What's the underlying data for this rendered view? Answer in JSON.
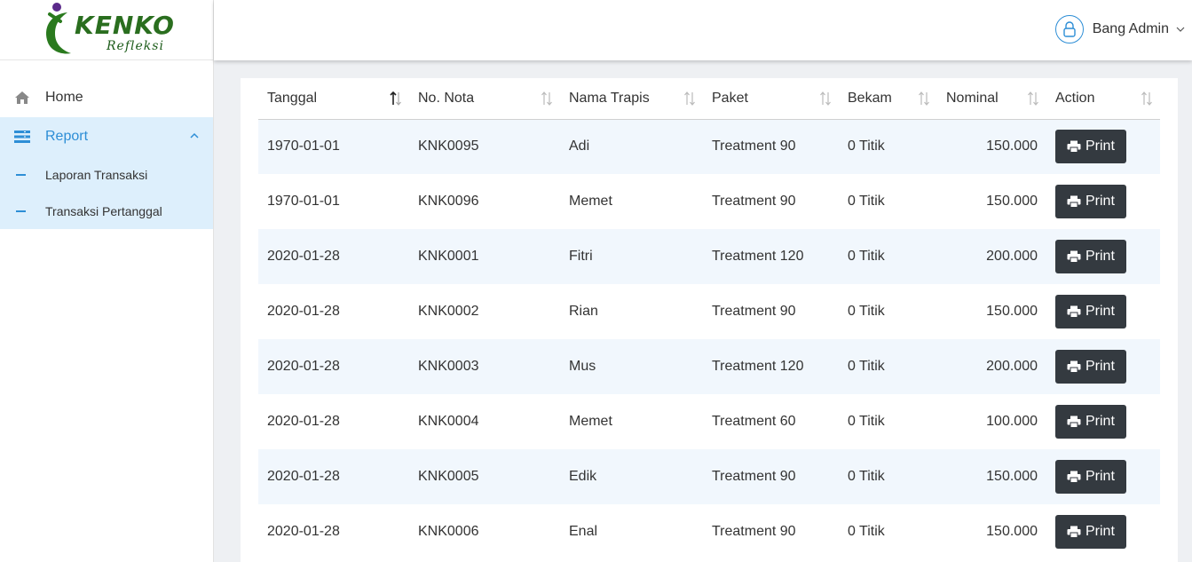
{
  "brand": {
    "name": "KENKO",
    "sub": "Refleksi"
  },
  "user": {
    "name": "Bang Admin"
  },
  "sidebar": {
    "home": "Home",
    "report": "Report",
    "sub": [
      "Laporan Transaksi",
      "Transaksi Pertanggal"
    ]
  },
  "table": {
    "headers": [
      "Tanggal",
      "No. Nota",
      "Nama Trapis",
      "Paket",
      "Bekam",
      "Nominal",
      "Action"
    ],
    "rows": [
      {
        "tanggal": "1970-01-01",
        "nota": "KNK0095",
        "trapis": "Adi",
        "paket": "Treatment 90",
        "bekam": "0 Titik",
        "nominal": "150.000",
        "action": "Print"
      },
      {
        "tanggal": "1970-01-01",
        "nota": "KNK0096",
        "trapis": "Memet",
        "paket": "Treatment 90",
        "bekam": "0 Titik",
        "nominal": "150.000",
        "action": "Print"
      },
      {
        "tanggal": "2020-01-28",
        "nota": "KNK0001",
        "trapis": "Fitri",
        "paket": "Treatment 120",
        "bekam": "0 Titik",
        "nominal": "200.000",
        "action": "Print"
      },
      {
        "tanggal": "2020-01-28",
        "nota": "KNK0002",
        "trapis": "Rian",
        "paket": "Treatment 90",
        "bekam": "0 Titik",
        "nominal": "150.000",
        "action": "Print"
      },
      {
        "tanggal": "2020-01-28",
        "nota": "KNK0003",
        "trapis": "Mus",
        "paket": "Treatment 120",
        "bekam": "0 Titik",
        "nominal": "200.000",
        "action": "Print"
      },
      {
        "tanggal": "2020-01-28",
        "nota": "KNK0004",
        "trapis": "Memet",
        "paket": "Treatment 60",
        "bekam": "0 Titik",
        "nominal": "100.000",
        "action": "Print"
      },
      {
        "tanggal": "2020-01-28",
        "nota": "KNK0005",
        "trapis": "Edik",
        "paket": "Treatment 90",
        "bekam": "0 Titik",
        "nominal": "150.000",
        "action": "Print"
      },
      {
        "tanggal": "2020-01-28",
        "nota": "KNK0006",
        "trapis": "Enal",
        "paket": "Treatment 90",
        "bekam": "0 Titik",
        "nominal": "150.000",
        "action": "Print"
      }
    ]
  }
}
